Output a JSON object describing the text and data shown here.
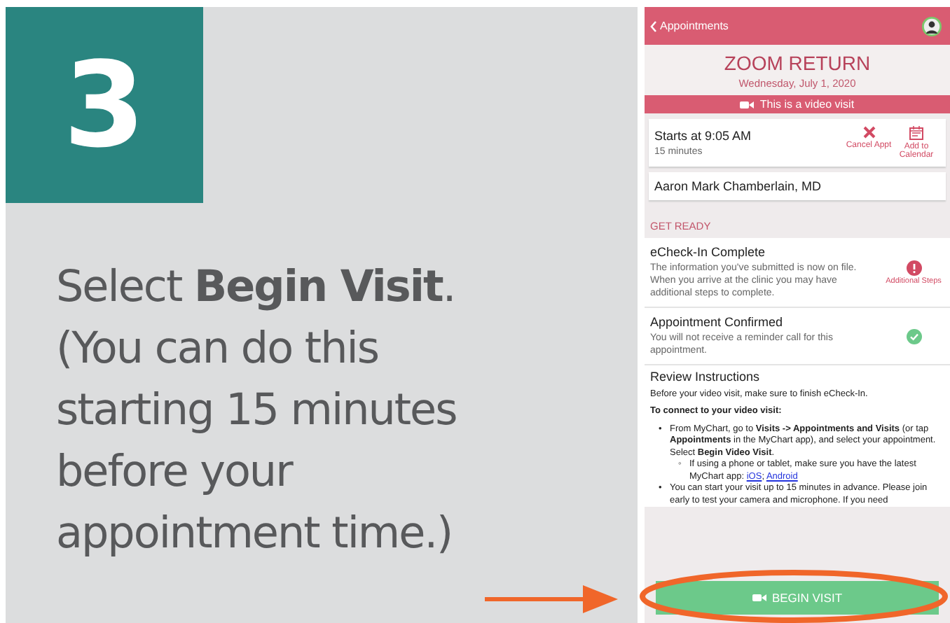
{
  "step": {
    "number": "3",
    "lines": [
      "Select **Begin Visit**.",
      "(You can do this",
      "starting 15 minutes",
      "before your",
      "appointment time.)"
    ]
  },
  "phone": {
    "header": {
      "back_label": "Appointments"
    },
    "title": "ZOOM RETURN",
    "date": "Wednesday, July 1, 2020",
    "banner": "This is a video visit",
    "time_card": {
      "starts": "Starts at 9:05 AM",
      "duration": "15 minutes",
      "actions": [
        {
          "kind": "cancel",
          "label": "Cancel Appt"
        },
        {
          "kind": "calendar",
          "label": "Add to Calendar"
        }
      ]
    },
    "provider": "Aaron Mark Chamberlain, MD",
    "section_heading": "GET READY",
    "tasks": [
      {
        "title": "eCheck-In Complete",
        "text": "The information you've submitted is now on file. When you arrive at the clinic you may have additional steps to complete.",
        "kind": "warning",
        "status_label": "Additional Steps"
      },
      {
        "title": "Appointment Confirmed",
        "text": "You will not receive a reminder call for this appointment.",
        "kind": "done"
      }
    ],
    "instructions": {
      "title": "Review Instructions",
      "intro": "Before your video visit, make sure to finish eCheck-In.",
      "heading": "To connect to your video visit:",
      "items": [
        {
          "marker": "•",
          "text": "From MyChart, go to **Visits -> Appointments and Visits** (or tap **Appointments** in the MyChart app), and select your appointment. Select **Begin Video Visit**.",
          "children": [
            {
              "marker": "◦",
              "text": "If using a phone or tablet, make sure you have the latest MyChart app:",
              "links": [
                "iOS",
                "Android"
              ],
              "separator": ";"
            }
          ]
        },
        {
          "marker": "•",
          "text": "You can start your visit up to 15 minutes in advance. Please join early to test your camera and microphone. If you need"
        }
      ]
    },
    "begin_button": "BEGIN VISIT"
  }
}
